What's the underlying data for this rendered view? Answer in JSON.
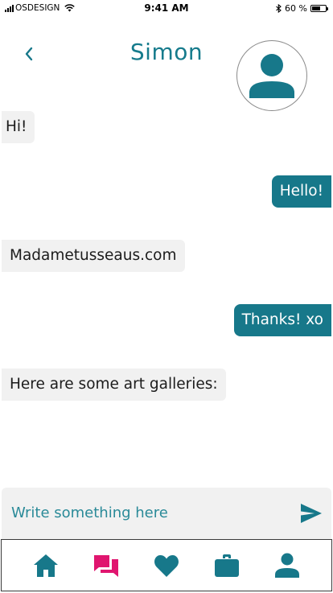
{
  "status_bar": {
    "carrier": "OSDESIGN",
    "time": "9:41 AM",
    "battery_percent_label": "60 %",
    "battery_level": 0.6
  },
  "header": {
    "title": "Simon",
    "back_icon": "chevron-left-icon",
    "avatar_icon": "person-icon"
  },
  "messages": [
    {
      "direction": "in",
      "text": "Hi!"
    },
    {
      "direction": "out",
      "text": "Hello!"
    },
    {
      "direction": "in",
      "text": "Madametusseaus.com"
    },
    {
      "direction": "out",
      "text": "Thanks! xo"
    },
    {
      "direction": "in",
      "text": "Here are some art galleries:"
    }
  ],
  "composer": {
    "placeholder": "Write something here",
    "value": "",
    "send_icon": "send-icon"
  },
  "tab_bar": {
    "items": [
      {
        "icon": "home-icon",
        "active": false
      },
      {
        "icon": "chat-icon",
        "active": true
      },
      {
        "icon": "heart-icon",
        "active": false
      },
      {
        "icon": "briefcase-icon",
        "active": false
      },
      {
        "icon": "profile-icon",
        "active": false
      }
    ]
  },
  "colors": {
    "primary": "#17788a",
    "accent_active": "#e0156f",
    "incoming_bubble": "#f1f1f1",
    "outgoing_bubble": "#17788a"
  }
}
